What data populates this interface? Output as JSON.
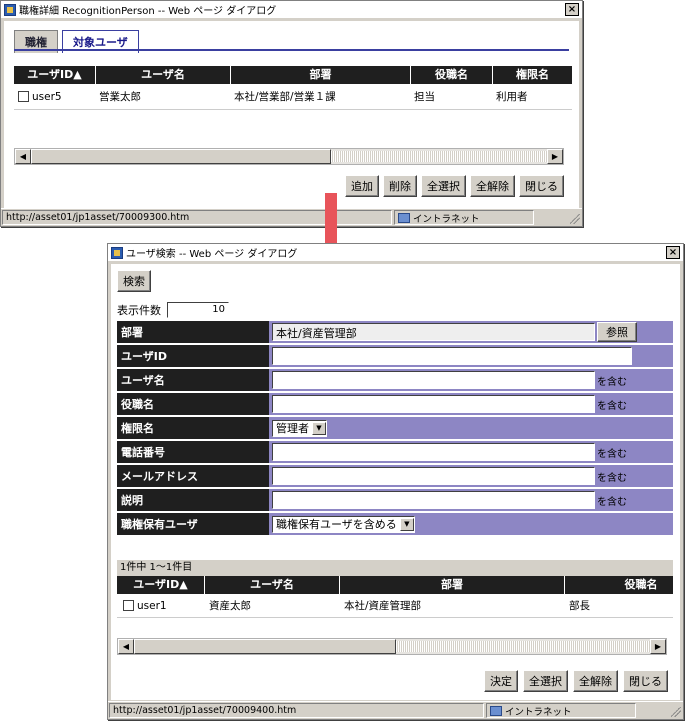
{
  "win1": {
    "title": "職権詳細 RecognitionPerson -- Web ページ ダイアログ",
    "tabs": [
      "職権",
      "対象ユーザ"
    ],
    "columns": [
      "ユーザID▲",
      "ユーザ名",
      "部署",
      "役職名",
      "権限名"
    ],
    "rows": [
      [
        "user5",
        "営業太郎",
        "本社/営業部/営業１課",
        "担当",
        "利用者"
      ]
    ],
    "buttons": {
      "add": "追加",
      "delete": "削除",
      "select_all": "全選択",
      "deselect_all": "全解除",
      "close": "閉じる"
    },
    "status_url": "http://asset01/jp1asset/70009300.htm",
    "status_zone": "イントラネット"
  },
  "win2": {
    "title": "ユーザ検索 -- Web ページ ダイアログ",
    "search_button": "検索",
    "display_count_label": "表示件数",
    "display_count_value": "10",
    "form": {
      "dept_label": "部署",
      "dept_value": "本社/資産管理部",
      "ref_button": "参照",
      "userid_label": "ユーザID",
      "username_label": "ユーザ名",
      "position_label": "役職名",
      "role_label": "権限名",
      "role_value": "管理者",
      "phone_label": "電話番号",
      "email_label": "メールアドレス",
      "desc_label": "説明",
      "holder_label": "職権保有ユーザ",
      "holder_value": "職権保有ユーザを含める",
      "contains": "を含む"
    },
    "result_count": "1件中 1〜1件目",
    "columns": [
      "ユーザID▲",
      "ユーザ名",
      "部署",
      "役職名"
    ],
    "rows": [
      [
        "user1",
        "資産太郎",
        "本社/資産管理部",
        "部長"
      ]
    ],
    "buttons": {
      "decide": "決定",
      "select_all": "全選択",
      "deselect_all": "全解除",
      "close": "閉じる"
    },
    "status_url": "http://asset01/jp1asset/70009400.htm",
    "status_zone": "イントラネット"
  },
  "colors": {
    "header_bg": "#1f1f1f",
    "field_bg": "#8d86c4",
    "arrow": "#e8545a",
    "tab_active": "#3a3fa0"
  }
}
